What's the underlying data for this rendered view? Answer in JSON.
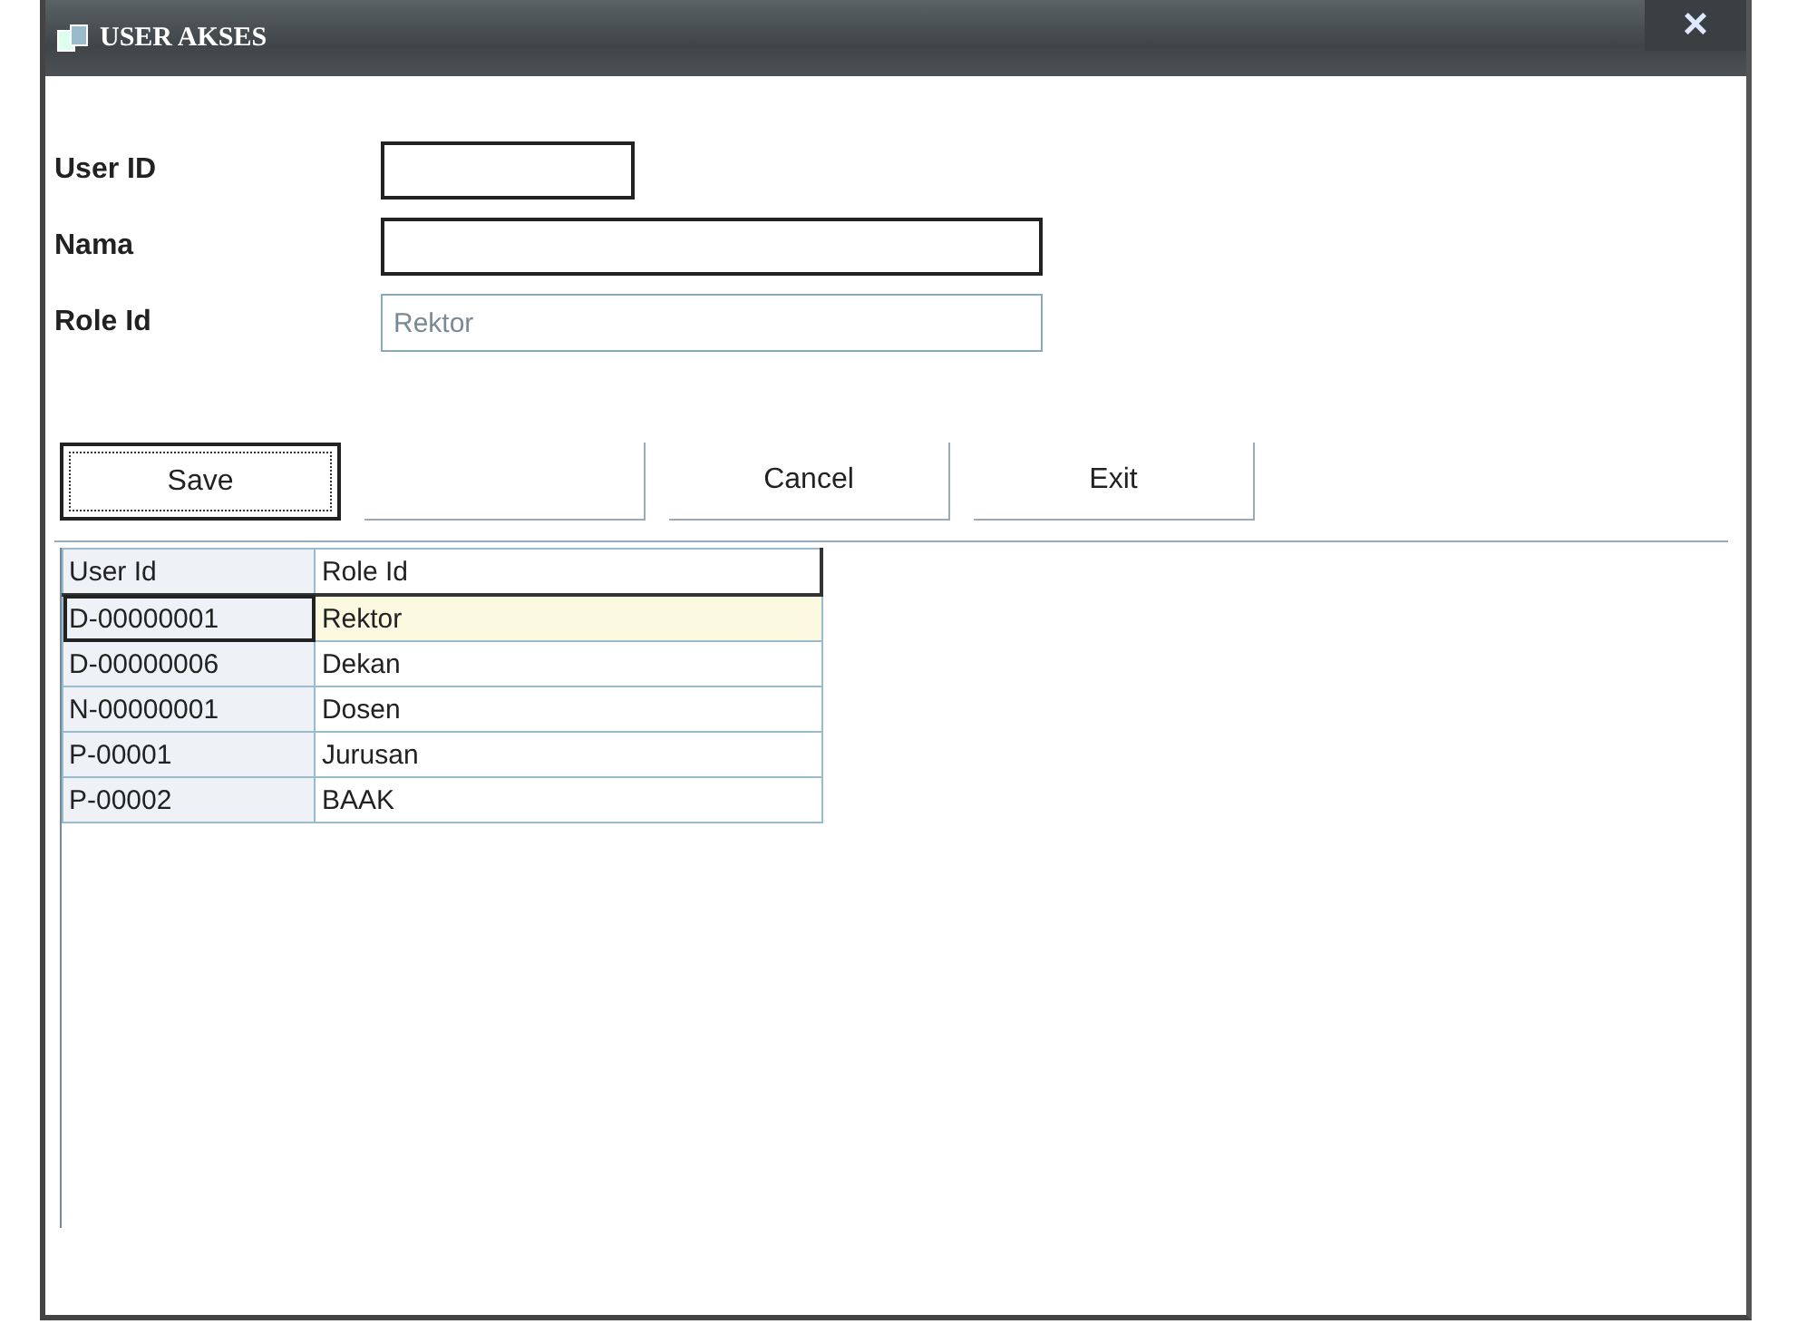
{
  "window": {
    "title": "USER AKSES",
    "close": "×"
  },
  "fields": [
    {
      "label": "User ID",
      "kind": "short"
    },
    {
      "label": "Nama",
      "kind": "long"
    },
    {
      "label": "Role Id",
      "kind": "combo",
      "value": "Rektor",
      "disabled": true
    }
  ],
  "buttons": [
    {
      "label": "Save",
      "focused": true
    },
    {
      "focused": false
    },
    {
      "label": "Cancel",
      "focused": false
    },
    {
      "label": "Exit",
      "focused": false
    }
  ],
  "table": {
    "columns": [
      "User Id",
      "Role Id"
    ],
    "rows": [
      {
        "cells": [
          "D-00000001",
          "Rektor"
        ],
        "selected": true
      },
      {
        "cells": [
          "D-00000006",
          "Dekan"
        ],
        "selected": false
      },
      {
        "cells": [
          "N-00000001",
          "Dosen"
        ],
        "selected": false
      },
      {
        "cells": [
          "P-00001",
          "Jurusan"
        ],
        "selected": false
      },
      {
        "cells": [
          "P-00002",
          "BAAK"
        ],
        "selected": false
      }
    ]
  }
}
